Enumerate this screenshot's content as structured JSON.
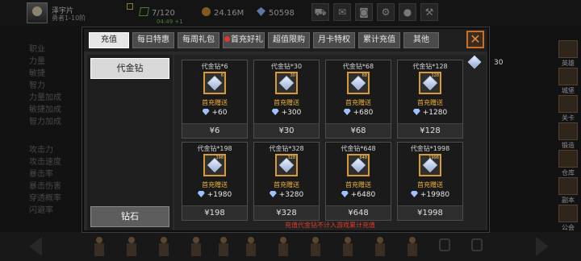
{
  "player": {
    "name": "泽宇片",
    "level": "勇者1-10阶"
  },
  "resources": {
    "stamina": "7/120",
    "stamina_timer": "04:49 +1",
    "gold": "24.16M",
    "gems": "50598"
  },
  "background_stats": [
    "职业",
    "力量",
    "敏捷",
    "智力",
    "力量加成",
    "敏捷加成",
    "智力加成",
    "攻击力",
    "攻击速度",
    "暴击率",
    "暴击伤害",
    "穿透概率",
    "闪避率"
  ],
  "right_nav": [
    "英雄",
    "城堡",
    "关卡",
    "锻造",
    "仓库",
    "副本",
    "公会",
    "跳斗"
  ],
  "shop": {
    "tabs": [
      {
        "label": "充值",
        "active": true
      },
      {
        "label": "每日特惠",
        "active": false
      },
      {
        "label": "每周礼包",
        "active": false
      },
      {
        "label": "首充好礼",
        "active": false,
        "badge": true
      },
      {
        "label": "超值限购",
        "active": false
      },
      {
        "label": "月卡特权",
        "active": false
      },
      {
        "label": "累计充值",
        "active": false
      },
      {
        "label": "其他",
        "active": false
      }
    ],
    "close_label": "✕",
    "categories": [
      "代金钻",
      "钻石"
    ],
    "owned": "30",
    "products": [
      {
        "name": "代金钻*6",
        "bonus": "首充赠送",
        "gems": "+60",
        "price": "¥6"
      },
      {
        "name": "代金钻*30",
        "bonus": "首充赠送",
        "gems": "+300",
        "price": "¥30"
      },
      {
        "name": "代金钻*68",
        "bonus": "首充赠送",
        "gems": "+680",
        "price": "¥68"
      },
      {
        "name": "代金钻*128",
        "bonus": "首充赠送",
        "gems": "+1280",
        "price": "¥128"
      },
      {
        "name": "代金钻*198",
        "bonus": "首充赠送",
        "gems": "+1980",
        "price": "¥198"
      },
      {
        "name": "代金钻*328",
        "bonus": "首充赠送",
        "gems": "+3280",
        "price": "¥328"
      },
      {
        "name": "代金钻*648",
        "bonus": "首充赠送",
        "gems": "+6480",
        "price": "¥648"
      },
      {
        "name": "代金钻*1998",
        "bonus": "首充赠送",
        "gems": "+19980",
        "price": "¥1998"
      }
    ],
    "icon_badges": [
      "6",
      "30",
      "68",
      "128",
      "198",
      "328",
      "648",
      "1998"
    ],
    "footer_note": "充值代金钻不计入游戏累计充值"
  },
  "icons": [
    "avatar",
    "pencil-icon",
    "stamina-icon",
    "gold-coin-icon",
    "gem-icon",
    "shop-cart-icon",
    "mail-icon",
    "gamepad-icon",
    "settings-icon",
    "google-icon",
    "tools-icon",
    "diamond-cube-icon",
    "close-icon",
    "lock-icon"
  ]
}
